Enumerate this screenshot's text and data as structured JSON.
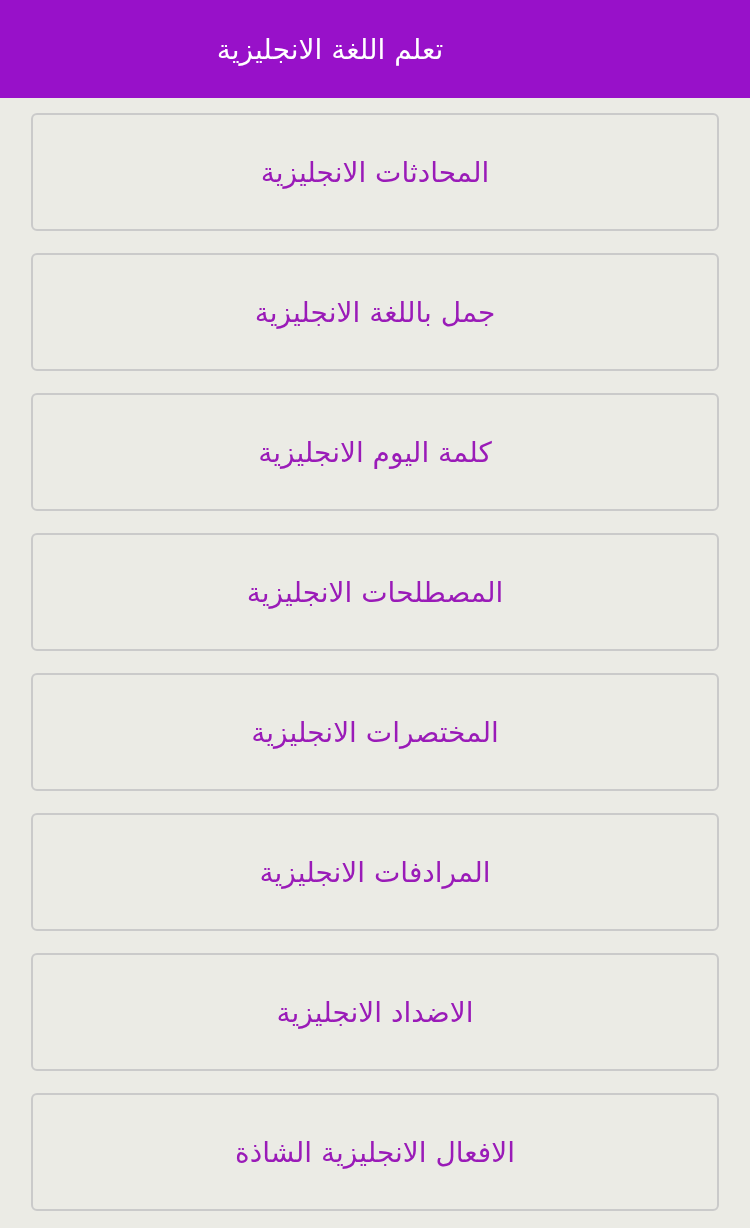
{
  "header": {
    "title": "تعلم اللغة الانجليزية"
  },
  "menu_items": [
    {
      "label": "المحادثات الانجليزية"
    },
    {
      "label": "جمل باللغة الانجليزية"
    },
    {
      "label": "كلمة اليوم الانجليزية"
    },
    {
      "label": "المصطلحات الانجليزية"
    },
    {
      "label": "المختصرات الانجليزية"
    },
    {
      "label": "المرادفات الانجليزية"
    },
    {
      "label": "الاضداد الانجليزية"
    },
    {
      "label": "الافعال الانجليزية الشاذة"
    }
  ]
}
